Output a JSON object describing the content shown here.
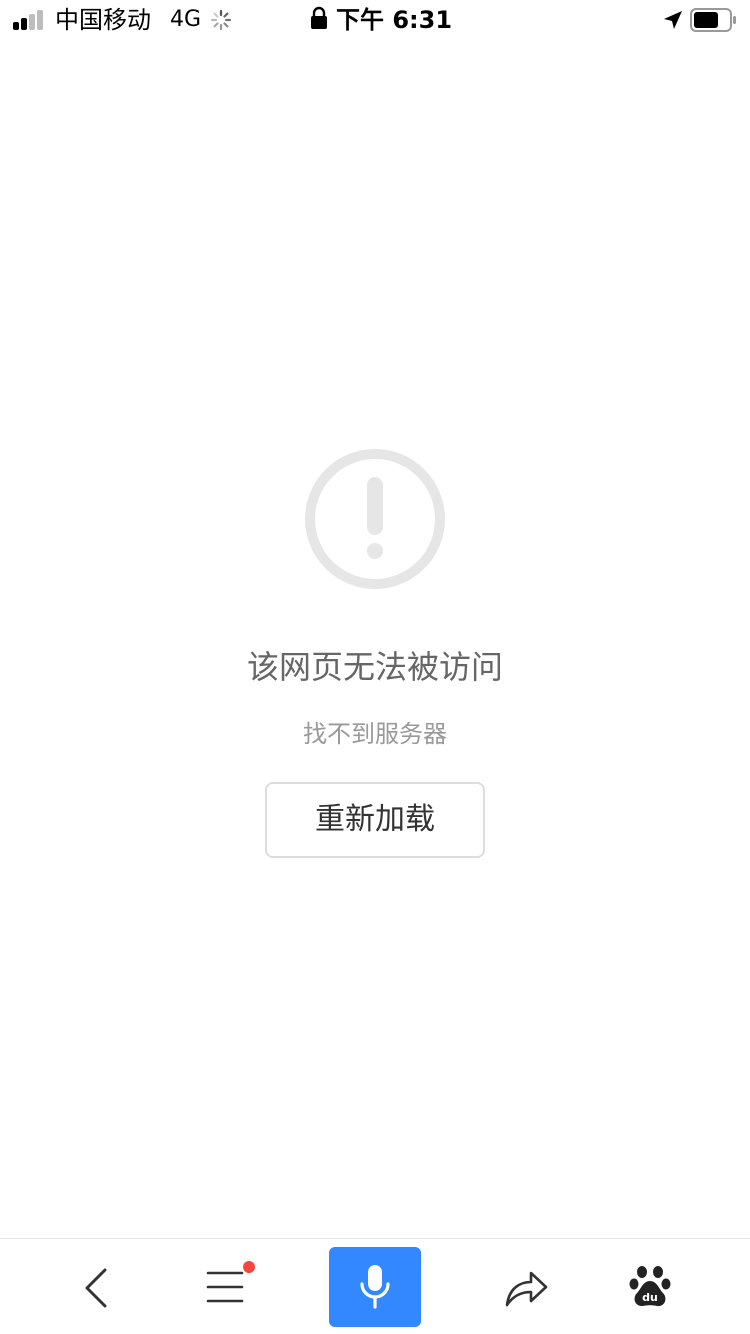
{
  "status_bar": {
    "carrier": "中国移动",
    "network": "4G",
    "time": "下午 6:31",
    "icons": [
      "signal-icon",
      "loading-spinner-icon",
      "lock-icon",
      "location-arrow-icon",
      "battery-icon"
    ]
  },
  "error": {
    "icon": "exclamation-circle-icon",
    "title": "该网页无法被访问",
    "subtitle": "找不到服务器",
    "reload_label": "重新加载"
  },
  "toolbar": {
    "items": [
      {
        "name": "back",
        "icon": "chevron-left-icon"
      },
      {
        "name": "menu",
        "icon": "hamburger-menu-icon",
        "badge": true
      },
      {
        "name": "voice",
        "icon": "microphone-icon"
      },
      {
        "name": "share",
        "icon": "share-arrow-icon"
      },
      {
        "name": "home",
        "icon": "baidu-paw-icon"
      }
    ]
  },
  "colors": {
    "accent": "#3388ff",
    "badge": "#f5453d",
    "title_text": "#666666",
    "subtitle_text": "#999999",
    "icon_gray": "#e6e6e6"
  }
}
